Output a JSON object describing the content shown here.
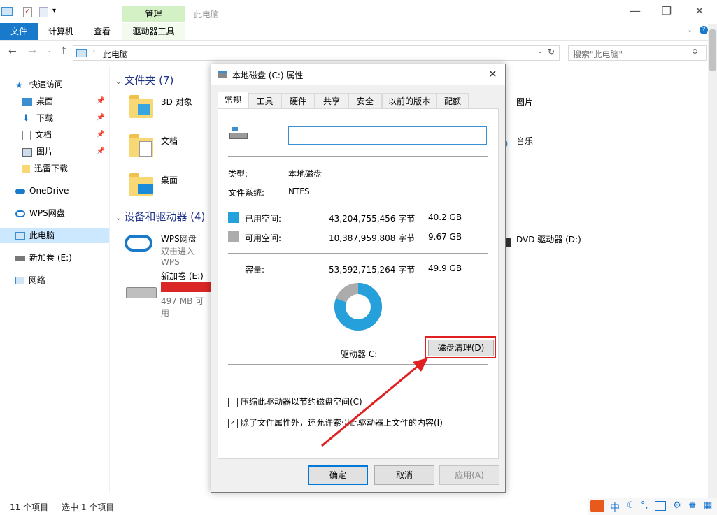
{
  "ribbon": {
    "context_header": "管理",
    "window_title": "此电脑",
    "tabs": [
      "文件",
      "计算机",
      "查看"
    ],
    "context_tab": "驱动器工具"
  },
  "address": {
    "path": "此电脑",
    "search_placeholder": "搜索\"此电脑\""
  },
  "nav": {
    "items": [
      {
        "label": "快速访问"
      },
      {
        "label": "桌面"
      },
      {
        "label": "下载"
      },
      {
        "label": "文档"
      },
      {
        "label": "图片"
      },
      {
        "label": "迅雷下载"
      },
      {
        "label": "OneDrive"
      },
      {
        "label": "WPS网盘"
      },
      {
        "label": "此电脑"
      },
      {
        "label": "新加卷 (E:)"
      },
      {
        "label": "网络"
      }
    ]
  },
  "content": {
    "folders_header": "文件夹 (7)",
    "folders": [
      "3D 对象",
      "文档",
      "桌面",
      "图片",
      "音乐"
    ],
    "devices_header": "设备和驱动器 (4)",
    "wps_title": "WPS网盘",
    "wps_sub": "双击进入WPS",
    "drive_e_title": "新加卷 (E:)",
    "drive_e_sub": "497 MB 可用",
    "dvd": "DVD 驱动器 (D:)"
  },
  "status": {
    "items": "11 个项目",
    "selected": "选中 1 个项目"
  },
  "dialog": {
    "title": "本地磁盘 (C:) 属性",
    "tabs": [
      "常规",
      "工具",
      "硬件",
      "共享",
      "安全",
      "以前的版本",
      "配额"
    ],
    "name_value": "",
    "type_label": "类型:",
    "type_value": "本地磁盘",
    "fs_label": "文件系统:",
    "fs_value": "NTFS",
    "used_label": "已用空间:",
    "used_bytes": "43,204,755,456 字节",
    "used_gb": "40.2 GB",
    "free_label": "可用空间:",
    "free_bytes": "10,387,959,808 字节",
    "free_gb": "9.67 GB",
    "cap_label": "容量:",
    "cap_bytes": "53,592,715,264 字节",
    "cap_gb": "49.9 GB",
    "used_fraction": 0.806,
    "drive_label": "驱动器 C:",
    "cleanup_button": "磁盘清理(D)",
    "compress_label": "压缩此驱动器以节约磁盘空间(C)",
    "compress_checked": false,
    "index_label": "除了文件属性外，还允许索引此驱动器上文件的内容(I)",
    "index_checked": true,
    "ok": "确定",
    "cancel": "取消",
    "apply": "应用(A)"
  },
  "colors": {
    "used": "#26a0da",
    "free": "#acacac",
    "accent": "#0078d7",
    "highlight": "#e02020"
  },
  "icons": [
    "computer-icon",
    "back-arrow-icon",
    "forward-arrow-icon",
    "up-arrow-icon",
    "refresh-icon",
    "search-icon",
    "star-icon",
    "pin-icon",
    "folder-icon",
    "cloud-icon",
    "drive-icon",
    "network-icon",
    "close-icon"
  ]
}
